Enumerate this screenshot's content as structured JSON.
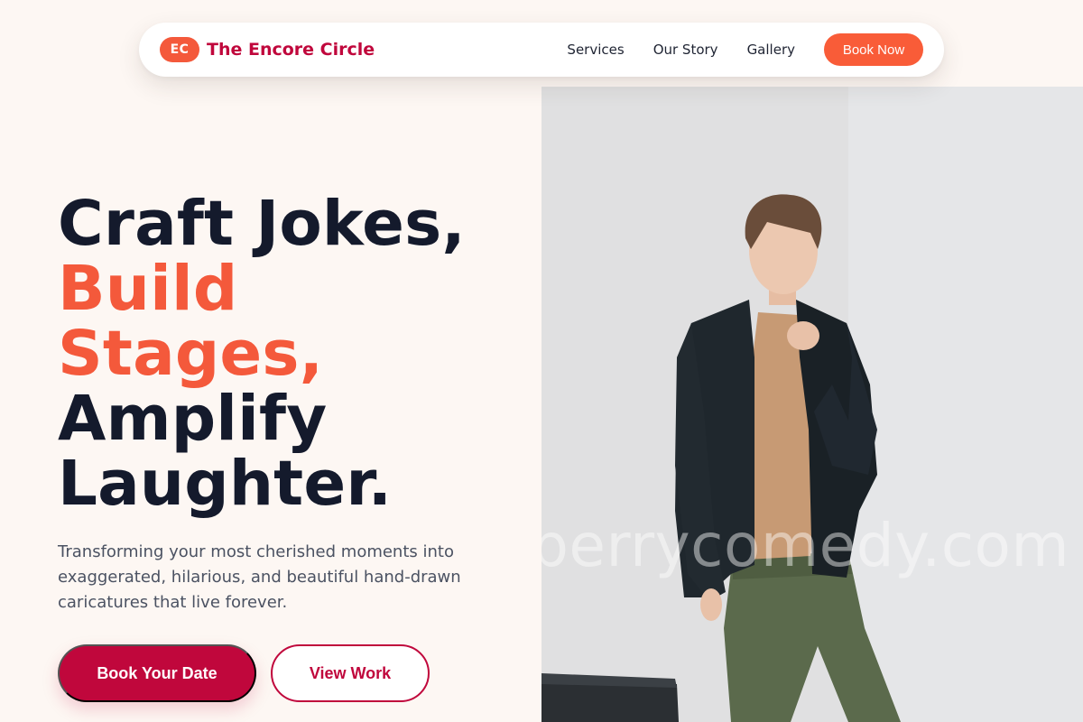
{
  "nav": {
    "logo_initials": "EC",
    "brand_name": "The Encore Circle",
    "links": [
      {
        "label": "Services"
      },
      {
        "label": "Our Story"
      },
      {
        "label": "Gallery"
      }
    ],
    "cta_label": "Book Now"
  },
  "hero": {
    "headline": {
      "line1": "Craft Jokes,",
      "line2": "Build",
      "line3": "Stages,",
      "line4": "Amplify",
      "line5": "Laughter."
    },
    "subtitle": "Transforming your most cherished moments into exaggerated, hilarious, and beautiful hand-drawn caricatures that live forever.",
    "primary_button": "Book Your Date",
    "secondary_button": "View Work",
    "image": {
      "watermark": "berrycomedy.com"
    }
  },
  "colors": {
    "accent": "#f4593b",
    "brand": "#c0073c",
    "text_dark": "#141a2c",
    "background": "#fdf7f3"
  }
}
